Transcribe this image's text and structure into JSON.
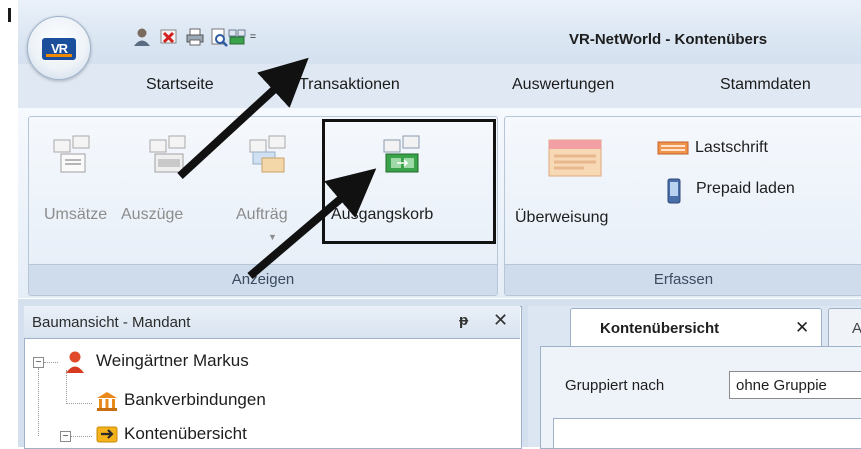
{
  "window": {
    "title": "VR-NetWorld - Kontenübers"
  },
  "app_button": {
    "logo_text": "VR"
  },
  "quick_access": {
    "items": [
      {
        "name": "user-icon"
      },
      {
        "name": "cancel-icon"
      },
      {
        "name": "print-icon"
      },
      {
        "name": "print-preview-icon"
      },
      {
        "name": "outbox-icon"
      }
    ],
    "dropdown_glyph": "="
  },
  "tabs": [
    "Startseite",
    "Transaktionen",
    "Auswertungen",
    "Stammdaten"
  ],
  "groups": {
    "anzeigen": {
      "label": "Anzeigen",
      "buttons": [
        "Umsätze",
        "Auszüge",
        "Aufträg",
        "Ausgangskorb"
      ]
    },
    "erfassen": {
      "label": "Erfassen",
      "buttons": [
        "Überweisung",
        "Lastschrift",
        "Prepaid laden"
      ]
    }
  },
  "tree_panel": {
    "title": "Baumansicht - Mandant",
    "pin_glyph": "ᵽ",
    "close_glyph": "✕",
    "items": [
      "Weingärtner Markus",
      "Bankverbindungen",
      "Kontenübersicht"
    ],
    "expanders": [
      "−",
      "−"
    ]
  },
  "document": {
    "tab_label": "Kontenübersicht",
    "tab_close": "✕",
    "tab2_label": "A",
    "group_label": "Gruppiert nach",
    "group_value": "ohne Gruppie"
  },
  "colors": {
    "highlight_border": "#121212",
    "arrow": "#111111",
    "ribbon_bg": "#e5edf7",
    "brand_blue": "#1b4f9c",
    "brand_orange": "#f28a00"
  }
}
